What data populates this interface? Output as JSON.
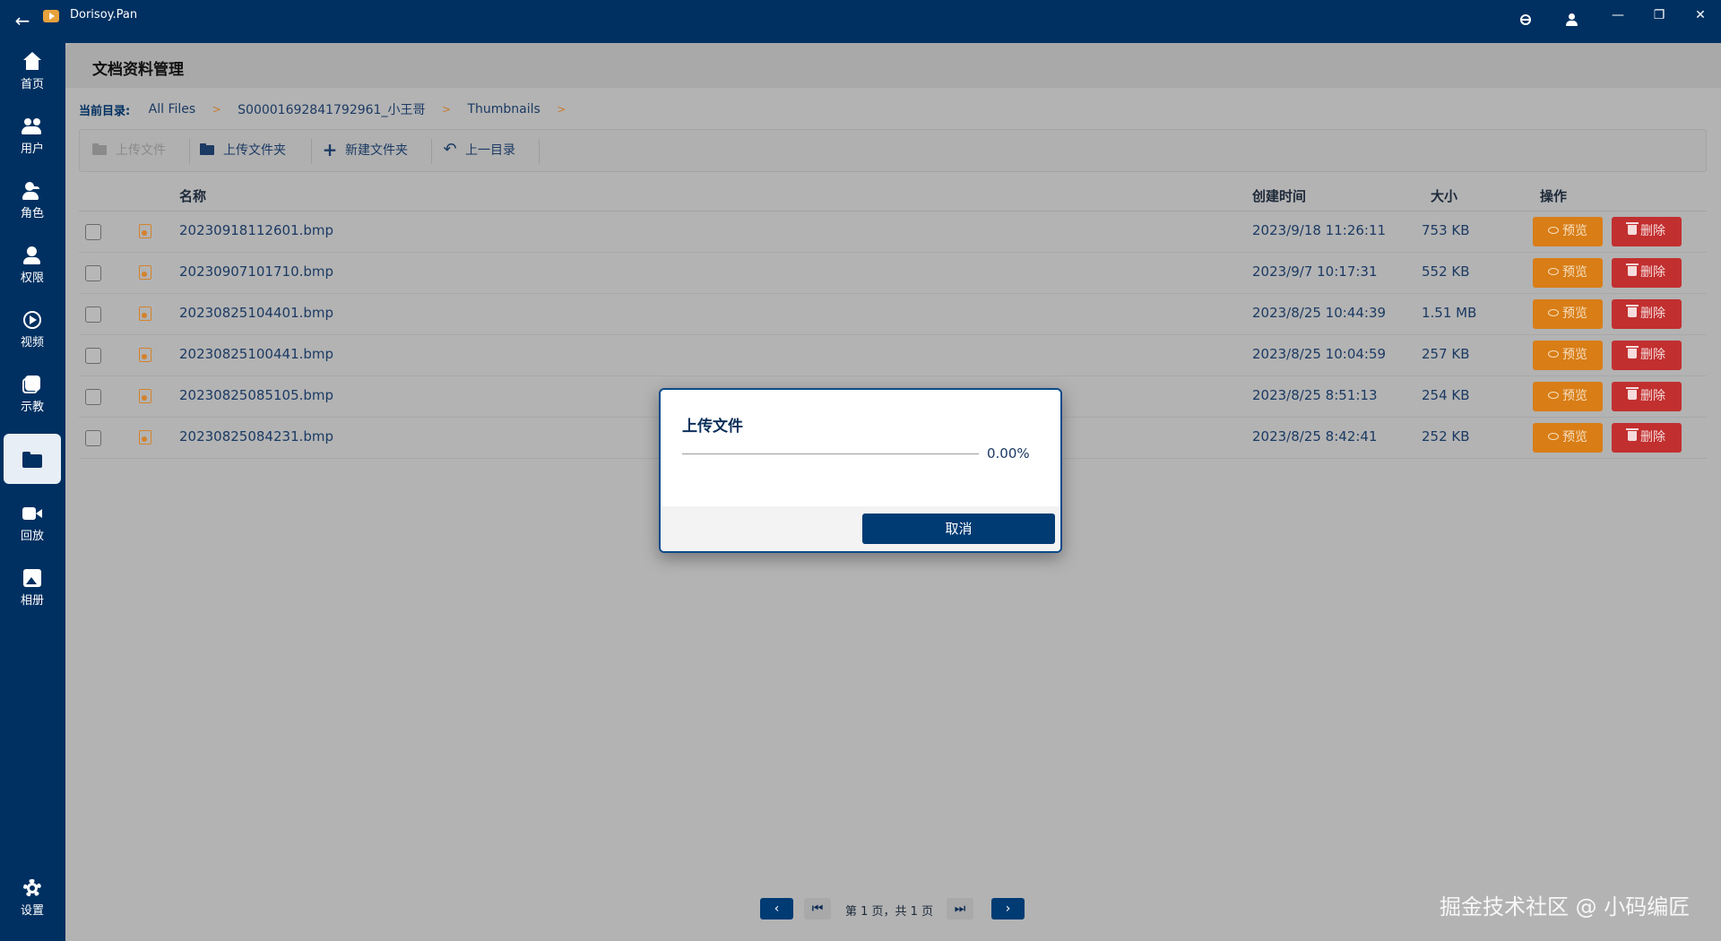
{
  "window": {
    "app_title": "Dorisoy.Pan",
    "icons": [
      "back-arrow-icon",
      "app-logo-icon",
      "globe-icon",
      "user-icon",
      "minimize-icon",
      "maximize-icon",
      "close-icon"
    ],
    "back_glyph": "←",
    "min_glyph": "—",
    "max_glyph": "❐",
    "close_glyph": "✕"
  },
  "sidebar": {
    "items": [
      {
        "label": "首页",
        "icon": "home-icon"
      },
      {
        "label": "用户",
        "icon": "users-icon"
      },
      {
        "label": "角色",
        "icon": "role-icon"
      },
      {
        "label": "权限",
        "icon": "permission-icon"
      },
      {
        "label": "视频",
        "icon": "video-icon"
      },
      {
        "label": "示教",
        "icon": "demo-icon"
      },
      {
        "label": "",
        "icon": "folder-icon",
        "active": true
      },
      {
        "label": "回放",
        "icon": "replay-icon"
      },
      {
        "label": "相册",
        "icon": "album-icon"
      }
    ],
    "settings_label": "设置"
  },
  "page": {
    "title": "文档资料管理",
    "breadcrumb": {
      "label": "当前目录:",
      "items": [
        "All Files",
        "S00001692841792961_小王哥",
        "Thumbnails"
      ],
      "sep": ">"
    },
    "toolbar": {
      "upload_file": "上传文件",
      "upload_folder": "上传文件夹",
      "new_folder": "新建文件夹",
      "parent_dir": "上一目录"
    }
  },
  "table": {
    "columns": [
      "名称",
      "创建时间",
      "大小",
      "操作"
    ],
    "preview_label": "预览",
    "delete_label": "删除",
    "rows": [
      {
        "name": "20230918112601.bmp",
        "created": "2023/9/18 11:26:11",
        "size": "753 KB"
      },
      {
        "name": "20230907101710.bmp",
        "created": "2023/9/7 10:17:31",
        "size": "552 KB"
      },
      {
        "name": "20230825104401.bmp",
        "created": "2023/8/25 10:44:39",
        "size": "1.51 MB"
      },
      {
        "name": "20230825100441.bmp",
        "created": "2023/8/25 10:04:59",
        "size": "257 KB"
      },
      {
        "name": "20230825085105.bmp",
        "created": "2023/8/25 8:51:13",
        "size": "254 KB"
      },
      {
        "name": "20230825084231.bmp",
        "created": "2023/8/25 8:42:41",
        "size": "252 KB"
      }
    ]
  },
  "pagination": {
    "info": "第 1 页，共 1 页",
    "prev_glyph": "‹",
    "first_glyph": "⏮",
    "last_glyph": "⏭",
    "next_glyph": "›"
  },
  "modal": {
    "title": "上传文件",
    "progress": 0.0,
    "progress_text": "0.00%",
    "cancel_label": "取消"
  },
  "watermark": "掘金技术社区 @ 小码编匠",
  "colors": {
    "primary": "#003061",
    "preview": "#d97d16",
    "delete": "#c22f2f",
    "accent": "#c87a2c"
  }
}
